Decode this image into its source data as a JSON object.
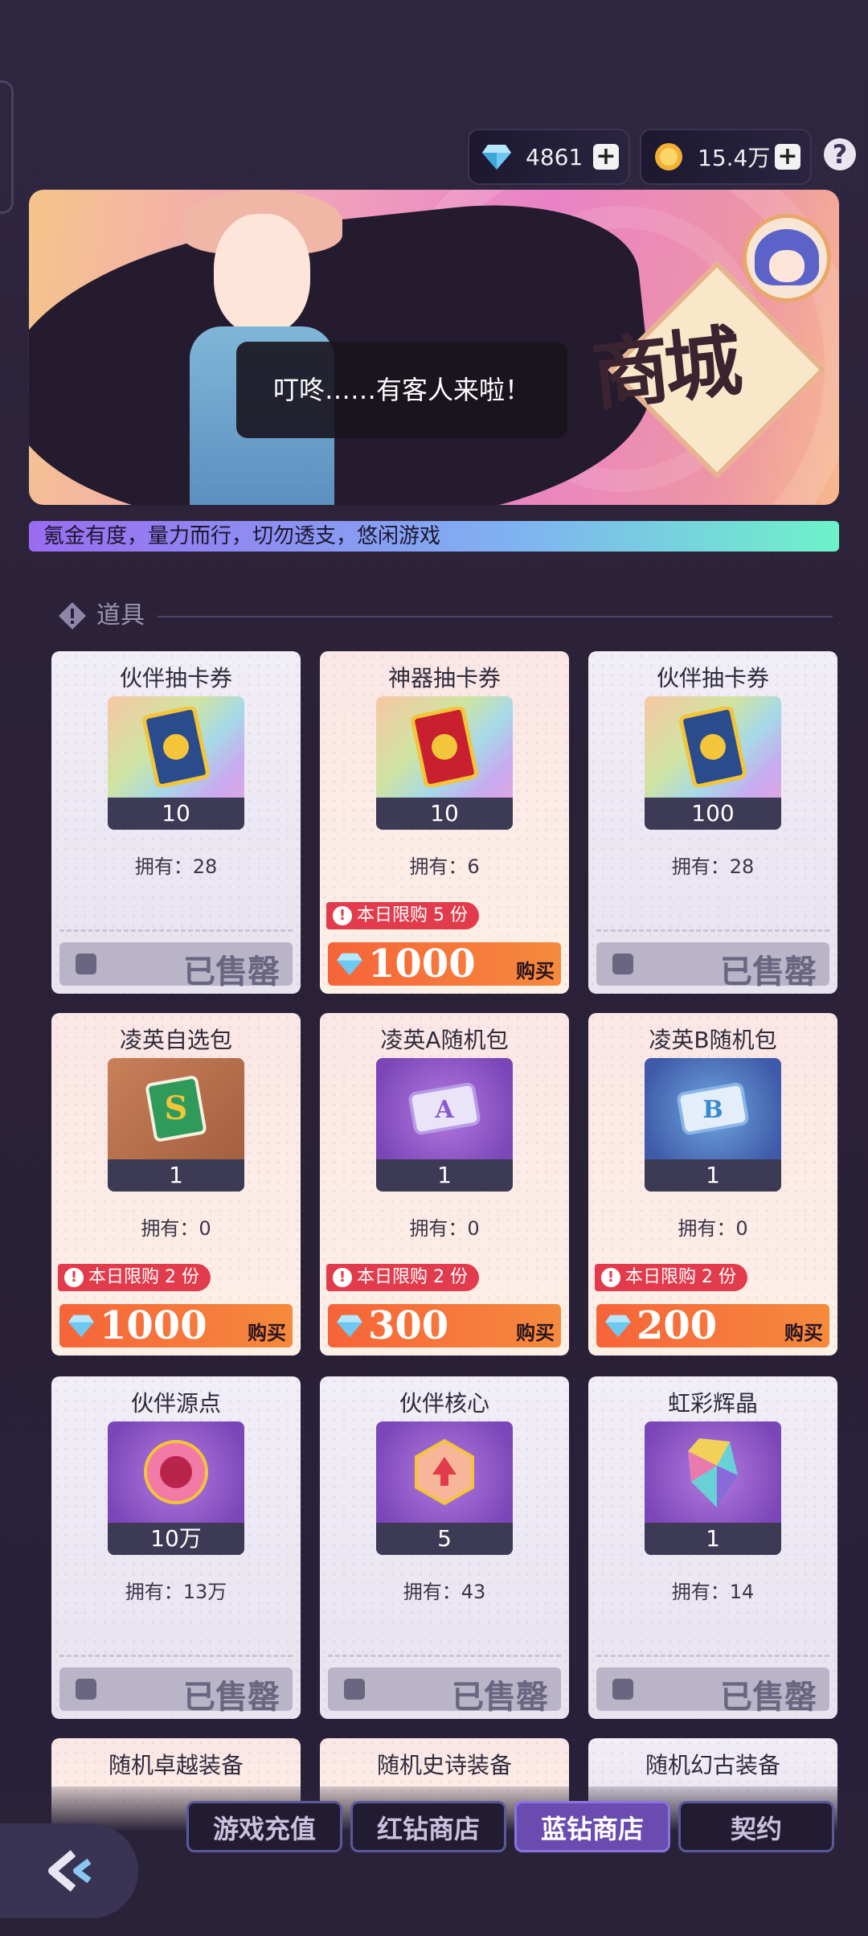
{
  "currency": {
    "gems": {
      "icon": "diamond-icon",
      "value": "4861"
    },
    "coins": {
      "icon": "coin-icon",
      "value": "15.4万"
    }
  },
  "banner": {
    "speech": "叮咚……有客人来啦！",
    "title": "商城"
  },
  "notice": "氪金有度，量力而行，切勿透支，悠闲游戏",
  "section": {
    "title": "道具"
  },
  "items": [
    {
      "name": "伙伴抽卡券",
      "qty": "10",
      "owned": "拥有：28",
      "limit": "",
      "price": "",
      "buy": "",
      "sold": "已售罄"
    },
    {
      "name": "神器抽卡券",
      "qty": "10",
      "owned": "拥有：6",
      "limit": "本日限购 5 份",
      "price": "1000",
      "buy": "购买",
      "sold": ""
    },
    {
      "name": "伙伴抽卡券",
      "qty": "100",
      "owned": "拥有：28",
      "limit": "",
      "price": "",
      "buy": "",
      "sold": "已售罄"
    },
    {
      "name": "凌英自选包",
      "qty": "1",
      "owned": "拥有：0",
      "limit": "本日限购 2 份",
      "price": "1000",
      "buy": "购买",
      "sold": ""
    },
    {
      "name": "凌英A随机包",
      "qty": "1",
      "owned": "拥有：0",
      "limit": "本日限购 2 份",
      "price": "300",
      "buy": "购买",
      "sold": ""
    },
    {
      "name": "凌英B随机包",
      "qty": "1",
      "owned": "拥有：0",
      "limit": "本日限购 2 份",
      "price": "200",
      "buy": "购买",
      "sold": ""
    },
    {
      "name": "伙伴源点",
      "qty": "10万",
      "owned": "拥有：13万",
      "limit": "",
      "price": "",
      "buy": "",
      "sold": "已售罄"
    },
    {
      "name": "伙伴核心",
      "qty": "5",
      "owned": "拥有：43",
      "limit": "",
      "price": "",
      "buy": "",
      "sold": "已售罄"
    },
    {
      "name": "虹彩辉晶",
      "qty": "1",
      "owned": "拥有：14",
      "limit": "",
      "price": "",
      "buy": "",
      "sold": "已售罄"
    },
    {
      "name": "随机卓越装备"
    },
    {
      "name": "随机史诗装备"
    },
    {
      "name": "随机幻古装备"
    }
  ],
  "tabs": [
    "游戏充值",
    "红钻商店",
    "蓝钻商店",
    "契约"
  ],
  "active_tab": "蓝钻商店"
}
